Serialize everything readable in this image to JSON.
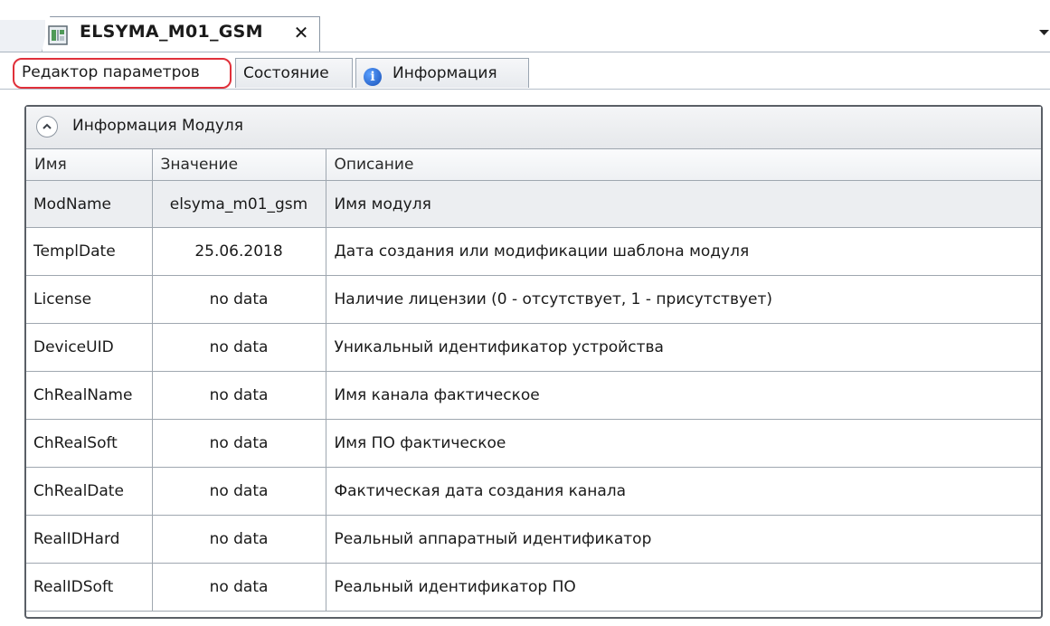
{
  "document_tab": {
    "title": "ELSYMA_M01_GSM",
    "close_glyph": "✕",
    "icon": "module-device-icon"
  },
  "subtabs": [
    {
      "label": "Редактор параметров",
      "active": true
    },
    {
      "label": "Состояние",
      "active": false
    },
    {
      "label": "Информация",
      "active": false,
      "icon": "info-icon"
    }
  ],
  "panel": {
    "title": "Информация Модуля",
    "collapse_icon": "chevron-up-icon"
  },
  "table": {
    "headers": {
      "name": "Имя",
      "value": "Значение",
      "description": "Описание"
    },
    "rows": [
      {
        "name": "ModName",
        "value": "elsyma_m01_gsm",
        "description": "Имя модуля"
      },
      {
        "name": "TemplDate",
        "value": "25.06.2018",
        "description": "Дата создания или модификации шаблона модуля"
      },
      {
        "name": "License",
        "value": "no data",
        "description": "Наличие лицензии (0 - отсутствует, 1 - присутствует)"
      },
      {
        "name": "DeviceUID",
        "value": "no data",
        "description": "Уникальный идентификатор устройства"
      },
      {
        "name": "ChRealName",
        "value": "no data",
        "description": "Имя канала фактическое"
      },
      {
        "name": "ChRealSoft",
        "value": "no data",
        "description": "Имя ПО фактическое"
      },
      {
        "name": "ChRealDate",
        "value": "no data",
        "description": "Фактическая дата создания канала"
      },
      {
        "name": "RealIDHard",
        "value": "no data",
        "description": "Реальный аппаратный идентификатор"
      },
      {
        "name": "RealIDSoft",
        "value": "no data",
        "description": "Реальный идентификатор ПО"
      }
    ]
  },
  "colors": {
    "highlight_border": "#e0303a",
    "panel_border": "#5a5f66",
    "grid_line": "#9fa7b0"
  }
}
